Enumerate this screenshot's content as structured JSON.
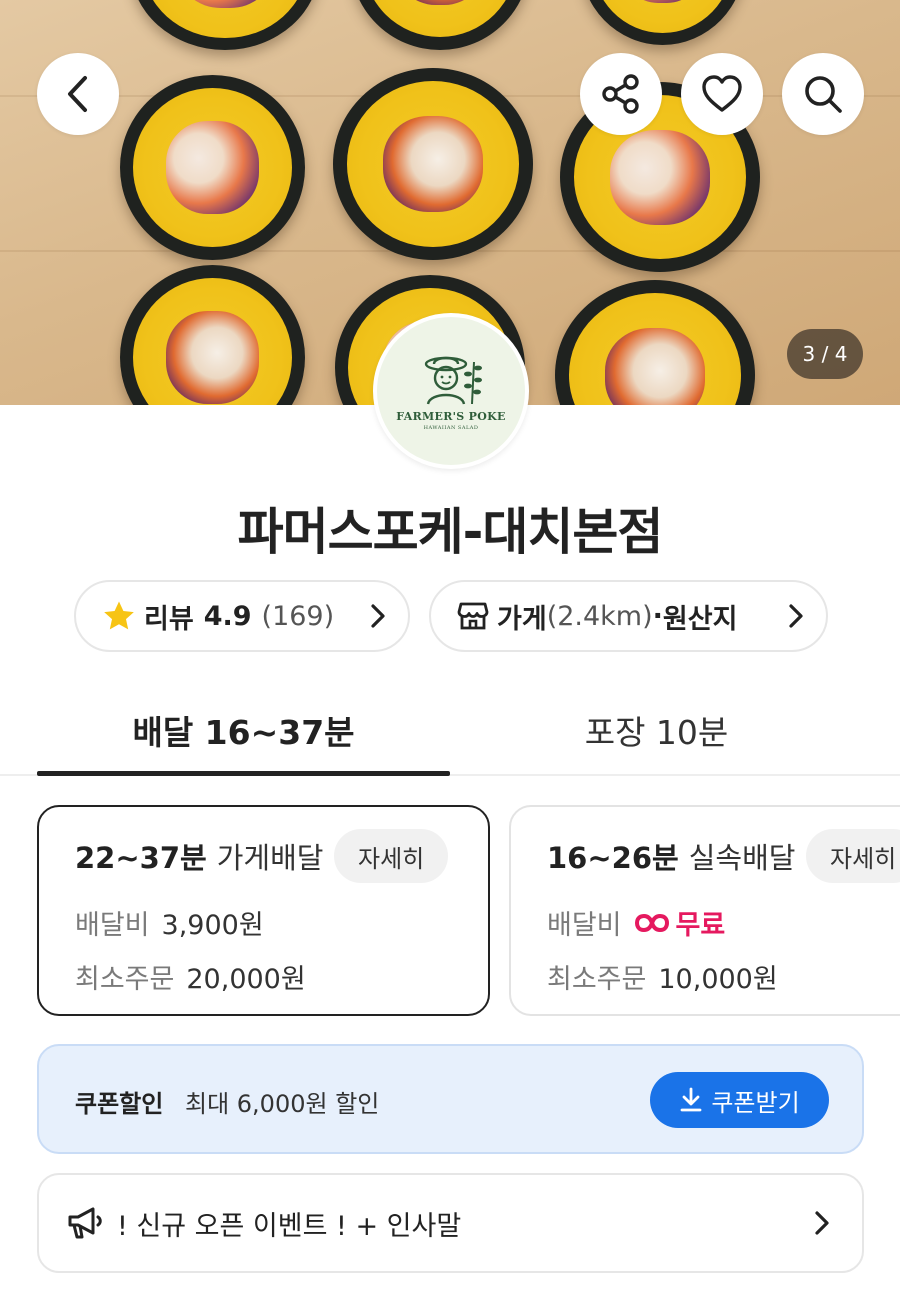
{
  "hero": {
    "page_indicator": "3 / 4",
    "back_icon": "chevron-left-icon",
    "share_icon": "share-icon",
    "favorite_icon": "heart-icon",
    "search_icon": "search-icon"
  },
  "logo": {
    "brand": "FARMER'S POKE",
    "subtitle": "HAWAIIAN SALAD"
  },
  "store": {
    "name": "파머스포케-대치본점"
  },
  "chips": {
    "review": {
      "label": "리뷰",
      "rating": "4.9",
      "count": "(169)"
    },
    "store_info": {
      "label": "가게",
      "distance": "(2.4km)",
      "separator": "·",
      "origin": "원산지"
    }
  },
  "tabs": [
    {
      "label": "배달 16~37분",
      "active": true
    },
    {
      "label": "포장 10분",
      "active": false
    }
  ],
  "delivery_options": [
    {
      "time": "22~37분",
      "type": "가게배달",
      "detail_label": "자세히",
      "fee_label": "배달비",
      "fee_value": "3,900원",
      "min_label": "최소주문",
      "min_value": "20,000원",
      "selected": true
    },
    {
      "time": "16~26분",
      "type": "실속배달",
      "detail_label": "자세히",
      "fee_label": "배달비",
      "fee_value": "무료",
      "min_label": "최소주문",
      "min_value": "10,000원",
      "selected": false
    }
  ],
  "coupon": {
    "label": "쿠폰할인",
    "description": "최대 6,000원 할인",
    "button_label": "쿠폰받기"
  },
  "notice": {
    "text": "! 신규 오픈 이벤트 ! + 인사말"
  },
  "colors": {
    "accent_blue": "#1a73e8",
    "coupon_bg": "#e7f0fc",
    "free_pink": "#e5195f",
    "star_yellow": "#f7c414"
  }
}
